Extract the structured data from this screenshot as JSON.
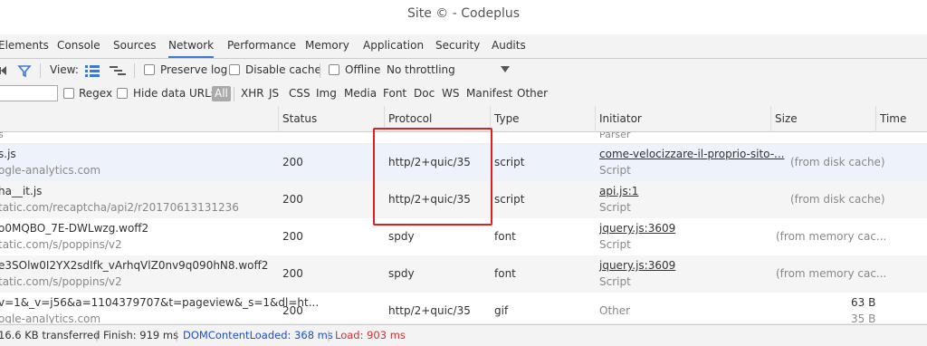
{
  "window": {
    "title": "Site © - Codeplus"
  },
  "tabs": [
    "Elements",
    "Console",
    "Sources",
    "Network",
    "Performance",
    "Memory",
    "Application",
    "Security",
    "Audits"
  ],
  "toolbar": {
    "view_label": "View:",
    "preserve_log": "Preserve log",
    "disable_cache": "Disable cache",
    "offline": "Offline",
    "throttling": "No throttling"
  },
  "filterbar": {
    "regex": "Regex",
    "hide_data_urls": "Hide data URLs",
    "types": [
      "All",
      "XHR",
      "JS",
      "CSS",
      "Img",
      "Media",
      "Font",
      "Doc",
      "WS",
      "Manifest",
      "Other"
    ]
  },
  "table": {
    "headers": [
      "Status",
      "Protocol",
      "Type",
      "Initiator",
      "Size",
      "Time"
    ],
    "partial_row": {
      "name_sub": "s",
      "initiator": "Parser"
    },
    "rows": [
      {
        "name": "s.js",
        "domain": "ogle-analytics.com",
        "status": "200",
        "protocol": "http/2+quic/35",
        "type": "script",
        "initiator": "come-velocizzare-il-proprio-sito-...",
        "initiator_sub": "Script",
        "size": "(from disk cache)"
      },
      {
        "name": "ha__it.js",
        "domain": "tatic.com/recaptcha/api2/r20170613131236",
        "status": "200",
        "protocol": "http/2+quic/35",
        "type": "script",
        "initiator": "api.js:1",
        "initiator_sub": "Script",
        "size": "(from disk cache)"
      },
      {
        "name": "o0MQBO_7E-DWLwzg.woff2",
        "domain": "tatic.com/s/poppins/v2",
        "status": "200",
        "protocol": "spdy",
        "type": "font",
        "initiator": "jquery.js:3609",
        "initiator_sub": "Script",
        "size": "(from memory cac..."
      },
      {
        "name": "e3SOlw0I2YX2sdIfk_vArhqVlZ0nv9q090hN8.woff2",
        "domain": "tatic.com/s/poppins/v2",
        "status": "200",
        "protocol": "spdy",
        "type": "font",
        "initiator": "jquery.js:3609",
        "initiator_sub": "Script",
        "size": "(from memory cac..."
      },
      {
        "name": "v=1&_v=j56&a=1104379707&t=pageview&_s=1&dl=ht...",
        "domain": "ogle-analytics.com",
        "status": "200",
        "protocol": "http/2+quic/35",
        "type": "gif",
        "initiator": "Other",
        "initiator_sub": "",
        "size": "63 B",
        "size_sub": "35 B"
      }
    ]
  },
  "statusbar": {
    "transferred": "16.6 KB transferred",
    "finish": "Finish: 919 ms",
    "domcontent": "DOMContentLoaded: 368 ms",
    "load": "Load: 903 ms",
    "dom_color": "#1a4ed8",
    "load_color": "#d32f2f"
  }
}
